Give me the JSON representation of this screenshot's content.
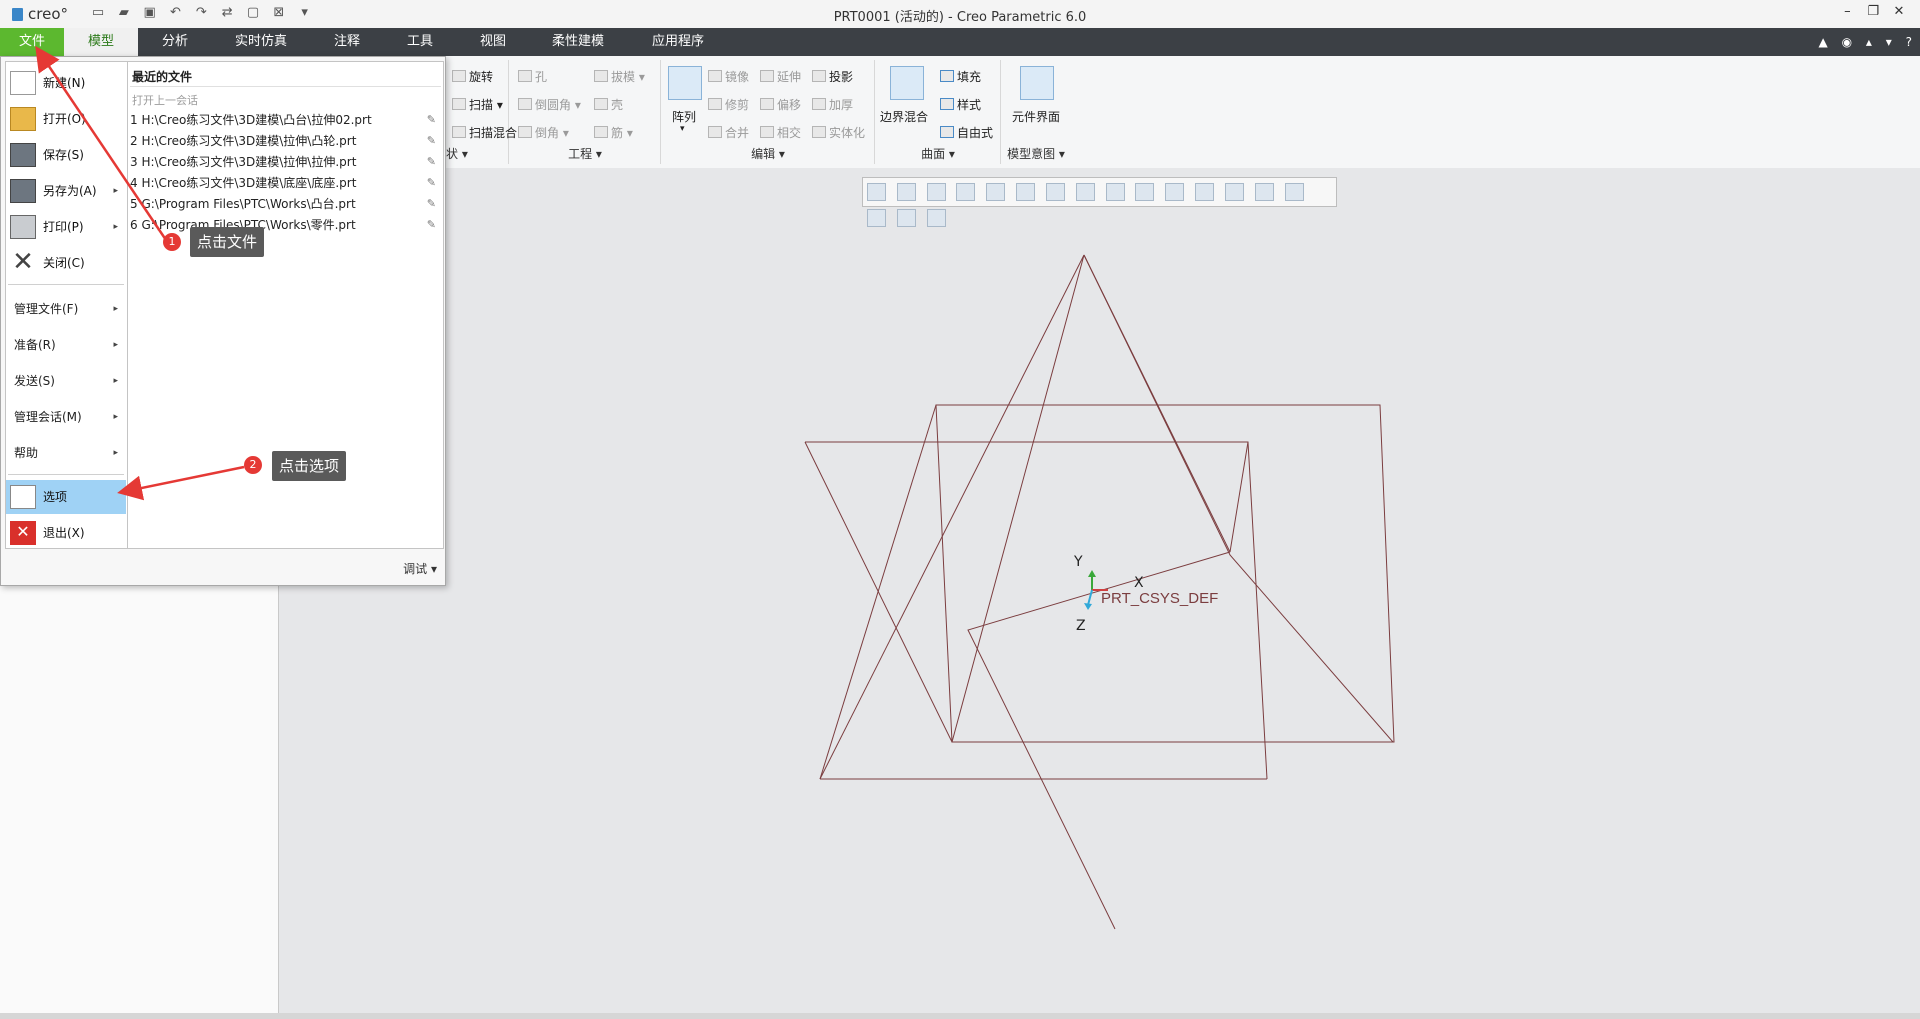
{
  "app": {
    "logo_text": "creo°",
    "window_title": "PRT0001 (活动的) - Creo Parametric 6.0",
    "quick_access_icons": [
      "new-icon",
      "open-icon",
      "save-icon",
      "undo-icon",
      "redo-icon",
      "regenerate-icon",
      "window-icon",
      "close-window-icon",
      "customize-icon"
    ],
    "window_controls": [
      "–",
      "🗗",
      "✕"
    ]
  },
  "menubar": {
    "tabs": [
      "文件",
      "模型",
      "分析",
      "实时仿真",
      "注释",
      "工具",
      "视图",
      "柔性建模",
      "应用程序"
    ],
    "active_tab": "模型",
    "right_icons": [
      "▲",
      "◉",
      "🎓",
      "▾",
      "?"
    ]
  },
  "ribbon": {
    "shape_group": {
      "items": [
        "旋转",
        "扫描",
        "扫描混合"
      ],
      "label": "状"
    },
    "engineering_group": {
      "label": "工程",
      "items": [
        "孔",
        "拔模",
        "倒圆角",
        "壳",
        "倒角",
        "筋"
      ]
    },
    "edit_group": {
      "label": "编辑",
      "array_label": "阵列",
      "items": [
        "镜像",
        "延伸",
        "投影",
        "修剪",
        "偏移",
        "加厚",
        "合并",
        "相交",
        "实体化"
      ]
    },
    "surface_group": {
      "label": "曲面",
      "boundary_label": "边界混合",
      "items": [
        "填充",
        "样式",
        "自由式"
      ]
    },
    "model_intent_group": {
      "label": "模型意图",
      "component_label": "元件界面"
    }
  },
  "file_menu": {
    "items": [
      {
        "label": "新建(N)",
        "icon": "new-file-icon"
      },
      {
        "label": "打开(O)",
        "icon": "open-folder-icon"
      },
      {
        "label": "保存(S)",
        "icon": "save-icon"
      },
      {
        "label": "另存为(A)",
        "icon": "save-as-icon",
        "arrow": "▸"
      },
      {
        "label": "打印(P)",
        "icon": "print-icon",
        "arrow": "▸"
      },
      {
        "label": "关闭(C)",
        "icon": "close-icon"
      }
    ],
    "sub_items": [
      {
        "label": "管理文件(F)",
        "arrow": "▸"
      },
      {
        "label": "准备(R)",
        "arrow": "▸"
      },
      {
        "label": "发送(S)",
        "arrow": "▸"
      },
      {
        "label": "管理会话(M)",
        "arrow": "▸"
      },
      {
        "label": "帮助",
        "arrow": "▸"
      }
    ],
    "options_label": "选项",
    "exit_label": "退出(X)",
    "recent_title": "最近的文件",
    "recent_subtitle": "打开上一会话",
    "recent_files": [
      "1 H:\\Creo练习文件\\3D建模\\凸台\\拉伸02.prt",
      "2 H:\\Creo练习文件\\3D建模\\拉伸\\凸轮.prt",
      "3 H:\\Creo练习文件\\3D建模\\拉伸\\拉伸.prt",
      "4 H:\\Creo练习文件\\3D建模\\底座\\底座.prt",
      "5 G:\\Program Files\\PTC\\Works\\凸台.prt",
      "6 G:\\Program Files\\PTC\\Works\\零件.prt"
    ],
    "debug_label": "调试 ▾"
  },
  "annotations": [
    {
      "badge": "1",
      "text": "点击文件"
    },
    {
      "badge": "2",
      "text": "点击选项"
    }
  ],
  "viewport": {
    "csys_label": "PRT_CSYS_DEF",
    "axis_x": "X",
    "axis_y": "Y",
    "axis_z": "Z",
    "view_toolbar_count": 18,
    "plane_color": "#7b3d3f"
  },
  "colors": {
    "file_tab": "#5cb82f",
    "menubar_bg": "#3c4045",
    "selection": "#9fd2f5",
    "callout_bg": "#5a5a5a",
    "badge": "#e53935",
    "arrow": "#e53935"
  }
}
